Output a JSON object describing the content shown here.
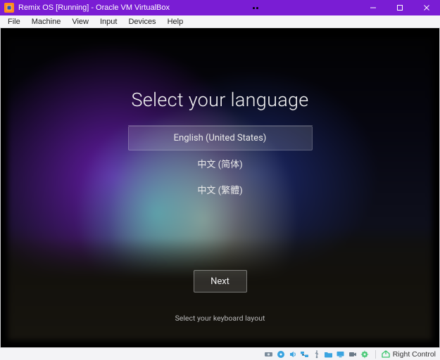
{
  "window": {
    "title": "Remix OS [Running] - Oracle VM VirtualBox"
  },
  "menubar": {
    "items": [
      "File",
      "Machine",
      "View",
      "Input",
      "Devices",
      "Help"
    ]
  },
  "setup": {
    "heading": "Select your language",
    "languages": [
      {
        "label": "English (United States)",
        "selected": true
      },
      {
        "label": "中文 (简体)",
        "selected": false
      },
      {
        "label": "中文 (繁體)",
        "selected": false
      }
    ],
    "next_label": "Next",
    "hint": "Select your keyboard layout"
  },
  "statusbar": {
    "hostkey_label": "Right Control",
    "icons": [
      "hard-disk-icon",
      "optical-drive-icon",
      "audio-icon",
      "network-icon",
      "usb-icon",
      "shared-folder-icon",
      "display-icon",
      "recording-icon",
      "cpu-icon"
    ]
  }
}
